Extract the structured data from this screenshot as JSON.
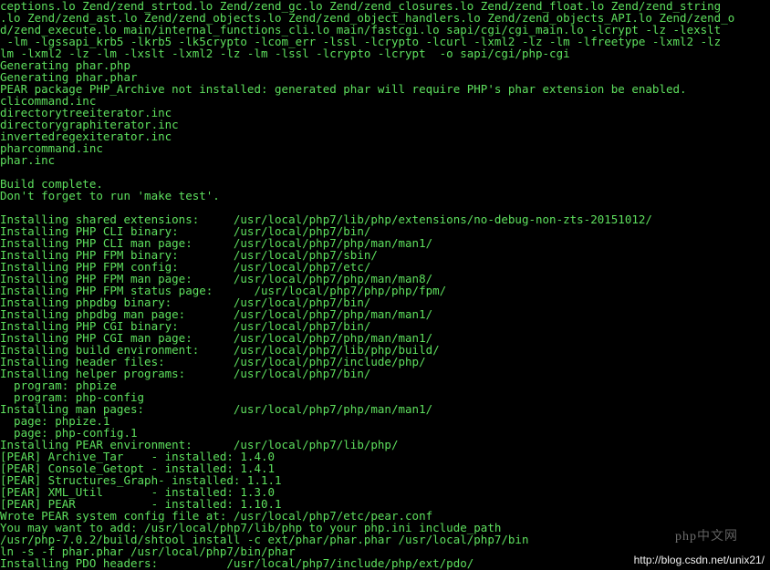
{
  "terminal": {
    "lines": [
      "ceptions.lo Zend/zend_strtod.lo Zend/zend_gc.lo Zend/zend_closures.lo Zend/zend_float.lo Zend/zend_string",
      ".lo Zend/zend_ast.lo Zend/zend_objects.lo Zend/zend_object_handlers.lo Zend/zend_objects_API.lo Zend/zend_o",
      "d/zend_execute.lo main/internal_functions_cli.lo main/fastcgi.lo sapi/cgi/cgi_main.lo -lcrypt -lz -lexslt",
      " -lm -lgssapi_krb5 -lkrb5 -lk5crypto -lcom_err -lssl -lcrypto -lcurl -lxml2 -lz -lm -lfreetype -lxml2 -lz",
      "lm -lxml2 -lz -lm -lxslt -lxml2 -lz -lm -lssl -lcrypto -lcrypt  -o sapi/cgi/php-cgi",
      "Generating phar.php",
      "Generating phar.phar",
      "PEAR package PHP_Archive not installed: generated phar will require PHP's phar extension be enabled.",
      "clicommand.inc",
      "directorytreeiterator.inc",
      "directorygraphiterator.inc",
      "invertedregexiterator.inc",
      "pharcommand.inc",
      "phar.inc",
      "",
      "Build complete.",
      "Don't forget to run 'make test'.",
      "",
      "Installing shared extensions:     /usr/local/php7/lib/php/extensions/no-debug-non-zts-20151012/",
      "Installing PHP CLI binary:        /usr/local/php7/bin/",
      "Installing PHP CLI man page:      /usr/local/php7/php/man/man1/",
      "Installing PHP FPM binary:        /usr/local/php7/sbin/",
      "Installing PHP FPM config:        /usr/local/php7/etc/",
      "Installing PHP FPM man page:      /usr/local/php7/php/man/man8/",
      "Installing PHP FPM status page:      /usr/local/php7/php/php/fpm/",
      "Installing phpdbg binary:         /usr/local/php7/bin/",
      "Installing phpdbg man page:       /usr/local/php7/php/man/man1/",
      "Installing PHP CGI binary:        /usr/local/php7/bin/",
      "Installing PHP CGI man page:      /usr/local/php7/php/man/man1/",
      "Installing build environment:     /usr/local/php7/lib/php/build/",
      "Installing header files:          /usr/local/php7/include/php/",
      "Installing helper programs:       /usr/local/php7/bin/",
      "  program: phpize",
      "  program: php-config",
      "Installing man pages:             /usr/local/php7/php/man/man1/",
      "  page: phpize.1",
      "  page: php-config.1",
      "Installing PEAR environment:      /usr/local/php7/lib/php/",
      "[PEAR] Archive_Tar    - installed: 1.4.0",
      "[PEAR] Console_Getopt - installed: 1.4.1",
      "[PEAR] Structures_Graph- installed: 1.1.1",
      "[PEAR] XML_Util       - installed: 1.3.0",
      "[PEAR] PEAR           - installed: 1.10.1",
      "Wrote PEAR system config file at: /usr/local/php7/etc/pear.conf",
      "You may want to add: /usr/local/php7/lib/php to your php.ini include_path",
      "/usr/php-7.0.2/build/shtool install -c ext/phar/phar.phar /usr/local/php7/bin",
      "ln -s -f phar.phar /usr/local/php7/bin/phar",
      "Installing PDO headers:          /usr/local/php7/include/php/ext/pdo/"
    ]
  },
  "watermark": {
    "php_site": "php中文网",
    "csdn_url": "http://blog.csdn.net/unix21/"
  }
}
